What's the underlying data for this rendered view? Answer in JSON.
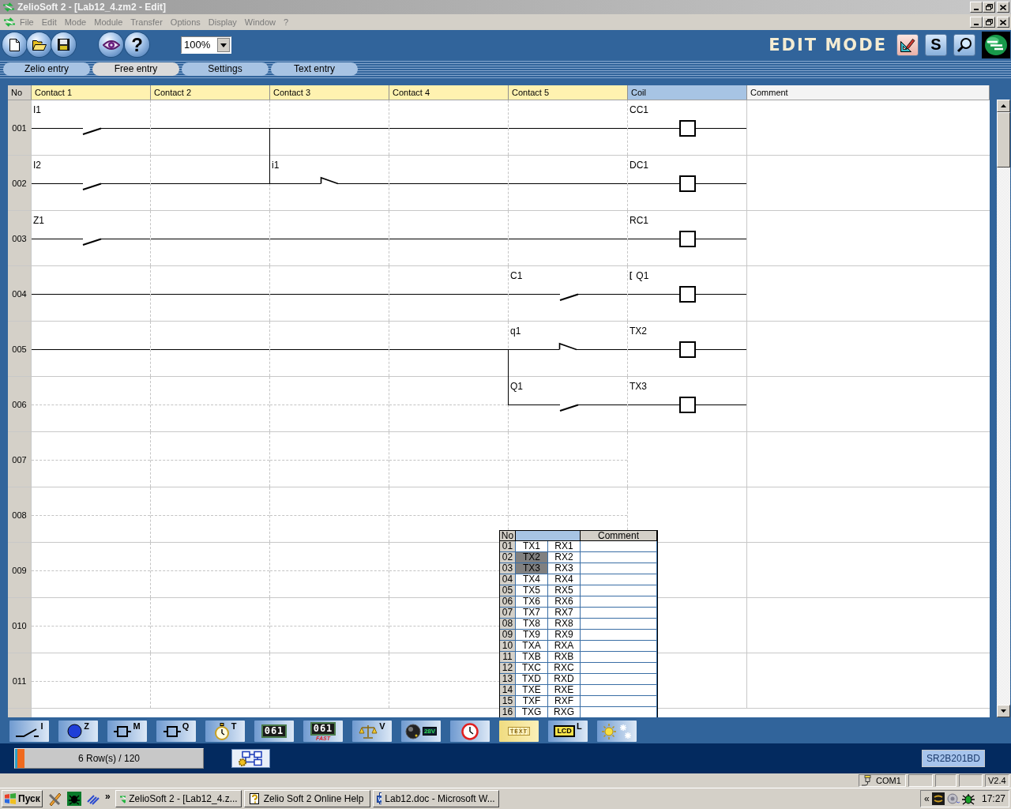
{
  "window": {
    "title": "ZelioSoft 2 - [Lab12_4.zm2 - Edit]"
  },
  "menu": [
    "File",
    "Edit",
    "Mode",
    "Module",
    "Transfer",
    "Options",
    "Display",
    "Window",
    "?"
  ],
  "toolbar": {
    "buttons": [
      {
        "kind": "new"
      },
      {
        "kind": "open"
      },
      {
        "kind": "save"
      },
      {
        "kind": "view"
      },
      {
        "kind": "help",
        "glyph": "?"
      }
    ],
    "zoom": "100%",
    "mode": "EDIT MODE",
    "tools": [
      {
        "kind": "edit"
      },
      {
        "kind": "simulate",
        "glyph": "S"
      },
      {
        "kind": "monitor"
      }
    ]
  },
  "tabs": [
    {
      "label": "Zelio entry",
      "selected": false
    },
    {
      "label": "Free entry",
      "selected": true
    },
    {
      "label": "Settings",
      "selected": false
    },
    {
      "label": "Text entry",
      "selected": false
    }
  ],
  "ladder": {
    "columns": [
      {
        "label": "No",
        "kind": "number"
      },
      {
        "label": "Contact 1",
        "kind": "contact"
      },
      {
        "label": "Contact 2",
        "kind": "contact"
      },
      {
        "label": "Contact 3",
        "kind": "contact"
      },
      {
        "label": "Contact 4",
        "kind": "contact"
      },
      {
        "label": "Contact 5",
        "kind": "contact"
      },
      {
        "label": "Coil",
        "kind": "coil"
      },
      {
        "label": "Comment",
        "kind": "comment"
      }
    ],
    "rows": [
      {
        "number": "001",
        "cells": [
          {
            "kind": "no",
            "label": "I1",
            "joins_above": false
          },
          {
            "kind": "wire",
            "joins_above": false
          },
          {
            "kind": "wire",
            "joins_above": false
          },
          {
            "kind": "wire",
            "joins_above": false
          },
          {
            "kind": "wire",
            "joins_above": false
          },
          {
            "kind": "coil",
            "label": "CC1",
            "joins_above": false
          }
        ]
      },
      {
        "number": "002",
        "cells": [
          {
            "kind": "no",
            "label": "I2",
            "joins_above": false
          },
          {
            "kind": "wire",
            "joins_above": false
          },
          {
            "kind": "nc",
            "label": "i1",
            "joins_above": true
          },
          {
            "kind": "wire",
            "joins_above": false
          },
          {
            "kind": "wire",
            "joins_above": false
          },
          {
            "kind": "coil",
            "label": "DC1",
            "joins_above": false
          }
        ]
      },
      {
        "number": "003",
        "cells": [
          {
            "kind": "no",
            "label": "Z1",
            "joins_above": false
          },
          {
            "kind": "wire",
            "joins_above": false
          },
          {
            "kind": "wire",
            "joins_above": false
          },
          {
            "kind": "wire",
            "joins_above": false
          },
          {
            "kind": "wire",
            "joins_above": false
          },
          {
            "kind": "coil",
            "label": "RC1",
            "joins_above": false
          }
        ]
      },
      {
        "number": "004",
        "cells": [
          {
            "kind": "wire",
            "joins_above": false
          },
          {
            "kind": "wire",
            "joins_above": false
          },
          {
            "kind": "wire",
            "joins_above": false
          },
          {
            "kind": "wire",
            "joins_above": false
          },
          {
            "kind": "no",
            "label": "C1",
            "joins_above": false
          },
          {
            "kind": "coil",
            "label": "Q1",
            "mark": "[",
            "joins_above": false
          }
        ]
      },
      {
        "number": "005",
        "cells": [
          {
            "kind": "wire",
            "joins_above": false
          },
          {
            "kind": "wire",
            "joins_above": false
          },
          {
            "kind": "wire",
            "joins_above": false
          },
          {
            "kind": "wire",
            "joins_above": false
          },
          {
            "kind": "nc",
            "label": "q1",
            "joins_above": false
          },
          {
            "kind": "coil",
            "label": "TX2",
            "joins_above": false
          }
        ]
      },
      {
        "number": "006",
        "cells": [
          {
            "kind": "empty",
            "joins_above": false
          },
          {
            "kind": "empty",
            "joins_above": false
          },
          {
            "kind": "empty",
            "joins_above": false
          },
          {
            "kind": "empty",
            "joins_above": false
          },
          {
            "kind": "no",
            "label": "Q1",
            "joins_above": true
          },
          {
            "kind": "coil",
            "label": "TX3",
            "joins_above": false
          }
        ]
      },
      {
        "number": "007"
      },
      {
        "number": "008"
      },
      {
        "number": "009"
      },
      {
        "number": "010"
      },
      {
        "number": "011"
      }
    ]
  },
  "link_table": {
    "columns": [
      {
        "label": "No",
        "kind": "number"
      },
      {
        "kind": "links"
      },
      {
        "label": "Comment",
        "kind": "comment"
      }
    ],
    "rows": [
      {
        "number": "01",
        "tx": "TX1",
        "rx": "RX1",
        "selected": false
      },
      {
        "number": "02",
        "tx": "TX2",
        "rx": "RX2",
        "selected": true
      },
      {
        "number": "03",
        "tx": "TX3",
        "rx": "RX3",
        "selected": true
      },
      {
        "number": "04",
        "tx": "TX4",
        "rx": "RX4",
        "selected": false
      },
      {
        "number": "05",
        "tx": "TX5",
        "rx": "RX5",
        "selected": false
      },
      {
        "number": "06",
        "tx": "TX6",
        "rx": "RX6",
        "selected": false
      },
      {
        "number": "07",
        "tx": "TX7",
        "rx": "RX7",
        "selected": false
      },
      {
        "number": "08",
        "tx": "TX8",
        "rx": "RX8",
        "selected": false
      },
      {
        "number": "09",
        "tx": "TX9",
        "rx": "RX9",
        "selected": false
      },
      {
        "number": "10",
        "tx": "TXA",
        "rx": "RXA",
        "selected": false
      },
      {
        "number": "11",
        "tx": "TXB",
        "rx": "RXB",
        "selected": false
      },
      {
        "number": "12",
        "tx": "TXC",
        "rx": "RXC",
        "selected": false
      },
      {
        "number": "13",
        "tx": "TXD",
        "rx": "RXD",
        "selected": false
      },
      {
        "number": "14",
        "tx": "TXE",
        "rx": "RXE",
        "selected": false
      },
      {
        "number": "15",
        "tx": "TXF",
        "rx": "RXF",
        "selected": false
      },
      {
        "number": "16",
        "tx": "TXG",
        "rx": "RXG",
        "selected": false
      }
    ]
  },
  "function_tools": [
    {
      "kind": "contact",
      "label": "I"
    },
    {
      "kind": "aux",
      "label": "Z"
    },
    {
      "kind": "relay",
      "label": "M"
    },
    {
      "kind": "output",
      "label": "Q"
    },
    {
      "kind": "timer",
      "label": "T"
    },
    {
      "kind": "counter",
      "display": "061"
    },
    {
      "kind": "fast-counter",
      "display": "061",
      "caption": "FAST"
    },
    {
      "kind": "compare",
      "label": "V"
    },
    {
      "kind": "analog",
      "display": "28V"
    },
    {
      "kind": "clock"
    },
    {
      "kind": "text",
      "display": "TEXT"
    },
    {
      "kind": "lcd",
      "display": "LCD",
      "label": "L"
    },
    {
      "kind": "season"
    }
  ],
  "status": {
    "rows": "6 Row(s) / 120",
    "level": 0.05,
    "module": "SR2B201BD"
  },
  "status_bar": {
    "port": "COM1",
    "version": "V2.4"
  },
  "taskbar": {
    "start": "Пуск",
    "more": "»",
    "tasks": [
      {
        "kind": "zelio",
        "label": "ZelioSoft 2 - [Lab12_4.z..."
      },
      {
        "kind": "help",
        "label": "Zelio Soft 2 Online Help"
      },
      {
        "kind": "word",
        "label": "Lab12.doc - Microsoft W..."
      }
    ],
    "tray_toggle": "«",
    "clock": "17:27"
  }
}
